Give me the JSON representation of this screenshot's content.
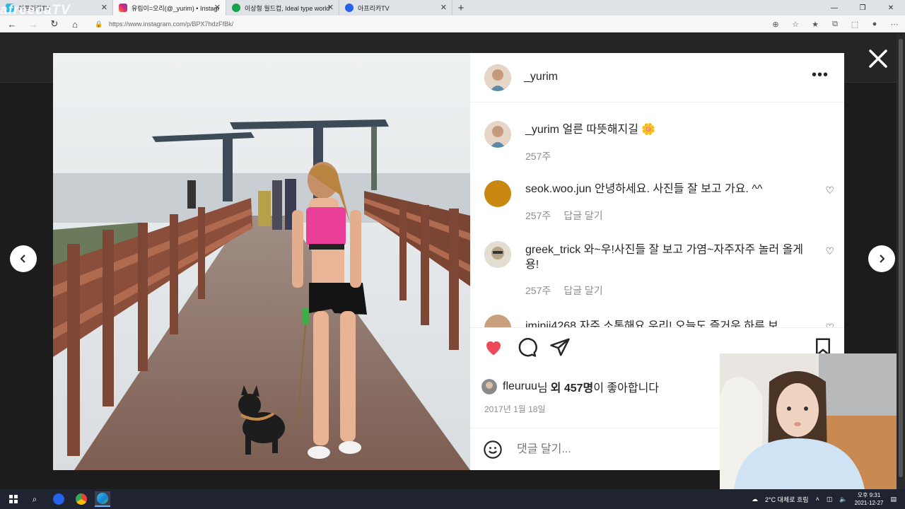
{
  "browser": {
    "watermark": "afreecaTV",
    "tabs": [
      {
        "title": "아프리카TV",
        "color": "#2eb8e6"
      },
      {
        "title": "유림이=오리(@_yurim) • Instagr",
        "color": "#d6249f"
      },
      {
        "title": "이상형 월드컵, Ideal type world",
        "color": "#16a34a"
      },
      {
        "title": "아프리카TV",
        "color": "#2563eb"
      }
    ],
    "new_tab": "+",
    "url": "https://www.instagram.com/p/BPX7hdzFfBk/"
  },
  "post": {
    "author": "_yurim",
    "caption": {
      "user": "_yurim",
      "text": "얼른 따뜻해지길",
      "emoji": "🌼",
      "time": "257주"
    },
    "comments": [
      {
        "user": "seok.woo.jun",
        "text": "안녕하세요. 사진들 잘 보고 가요. ^^",
        "time": "257주",
        "reply": "답글 달기",
        "avatar": "#c8870f"
      },
      {
        "user": "greek_trick",
        "text": "와~우!사진들 잘 보고 가염~자주자주 놀러 올게용!",
        "time": "257주",
        "reply": "답글 달기",
        "avatar": "#d9d4c6"
      },
      {
        "user": "iminji4268",
        "text": "자주 소통해요 우리! 오늘도 즐거운 하루 보",
        "time": "",
        "reply": "",
        "avatar": "#c9a07d"
      }
    ],
    "likes": {
      "user": "fleuruu",
      "mid": "님",
      "bold": "외 457명",
      "suffix": "이 좋아합니다"
    },
    "date": "2017년 1월 18일",
    "add_comment_placeholder": "댓글 달기..."
  },
  "tray": {
    "weather": "2°C  대체로 흐림",
    "time": "오후 9:31",
    "date": "2021-12-27"
  }
}
